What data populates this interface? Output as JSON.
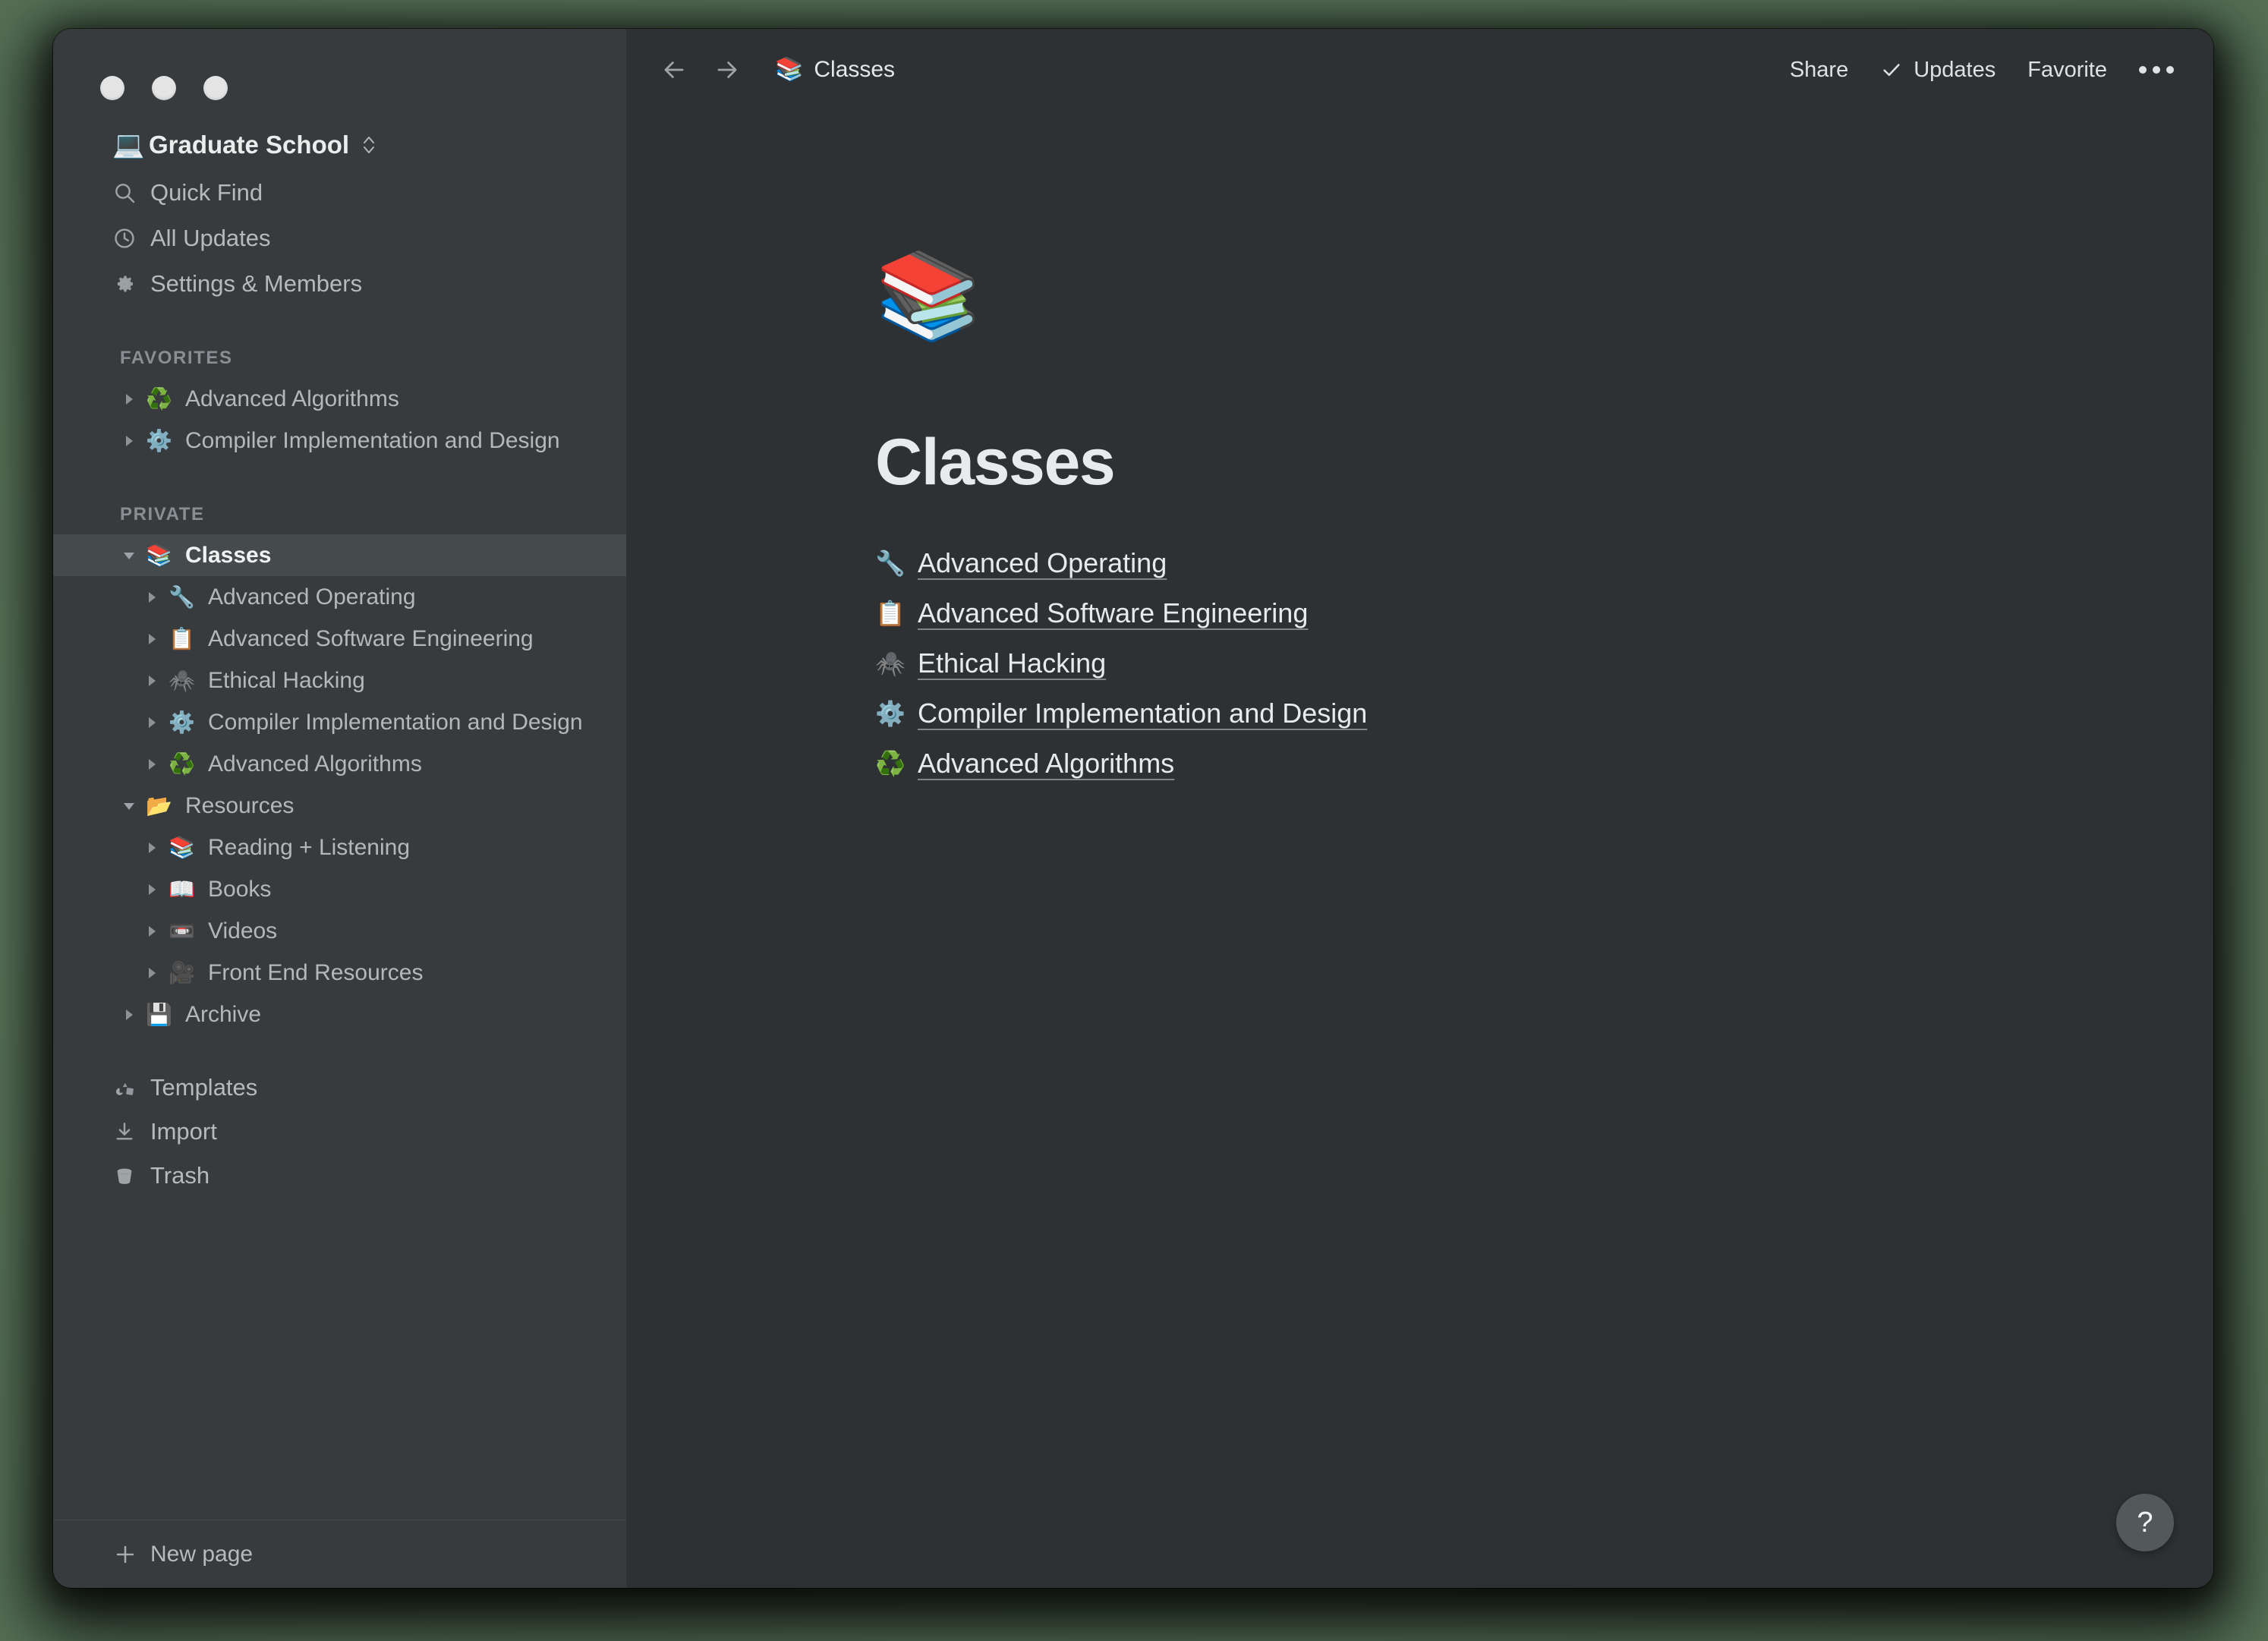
{
  "window": {
    "traffic_lights": [
      "close",
      "minimize",
      "zoom"
    ]
  },
  "sidebar": {
    "workspace": {
      "emoji": "💻",
      "icon_name": "laptop-emoji",
      "name": "Graduate School",
      "switcher_icon": "chevron-up-down-icon"
    },
    "nav": [
      {
        "label": "Quick Find",
        "icon": "search-icon"
      },
      {
        "label": "All Updates",
        "icon": "clock-icon"
      },
      {
        "label": "Settings & Members",
        "icon": "gear-icon"
      }
    ],
    "sections": [
      {
        "title": "FAVORITES",
        "items": [
          {
            "label": "Advanced Algorithms",
            "emoji": "♻️",
            "icon_name": "recycle-emoji",
            "expanded": false,
            "level": 0
          },
          {
            "label": "Compiler Implementation and Design",
            "emoji": "⚙️",
            "icon_name": "gear-emoji",
            "expanded": false,
            "level": 0
          }
        ]
      },
      {
        "title": "PRIVATE",
        "items": [
          {
            "label": "Classes",
            "emoji": "📚",
            "icon_name": "books-emoji",
            "expanded": true,
            "level": 0,
            "selected": true
          },
          {
            "label": "Advanced Operating",
            "emoji": "🔧",
            "icon_name": "wrench-emoji",
            "expanded": false,
            "level": 1
          },
          {
            "label": "Advanced Software Engineering",
            "emoji": "📋",
            "icon_name": "clipboard-emoji",
            "expanded": false,
            "level": 1
          },
          {
            "label": "Ethical Hacking",
            "emoji": "🕷️",
            "icon_name": "spider-emoji",
            "expanded": false,
            "level": 1
          },
          {
            "label": "Compiler Implementation and Design",
            "emoji": "⚙️",
            "icon_name": "gear-emoji",
            "expanded": false,
            "level": 1
          },
          {
            "label": "Advanced Algorithms",
            "emoji": "♻️",
            "icon_name": "recycle-emoji",
            "expanded": false,
            "level": 1
          },
          {
            "label": "Resources",
            "emoji": "📂",
            "icon_name": "open-folder-emoji",
            "expanded": true,
            "level": 0
          },
          {
            "label": "Reading + Listening",
            "emoji": "📚",
            "icon_name": "books-emoji",
            "expanded": false,
            "level": 1
          },
          {
            "label": "Books",
            "emoji": "📖",
            "icon_name": "open-book-emoji",
            "expanded": false,
            "level": 1
          },
          {
            "label": "Videos",
            "emoji": "📼",
            "icon_name": "videocassette-emoji",
            "expanded": false,
            "level": 1
          },
          {
            "label": "Front End Resources",
            "emoji": "🎥",
            "icon_name": "movie-camera-emoji",
            "expanded": false,
            "level": 1
          },
          {
            "label": "Archive",
            "emoji": "💾",
            "icon_name": "floppy-disk-emoji",
            "expanded": false,
            "level": 0
          }
        ]
      }
    ],
    "utilities": [
      {
        "label": "Templates",
        "icon": "templates-icon"
      },
      {
        "label": "Import",
        "icon": "import-icon"
      },
      {
        "label": "Trash",
        "icon": "trash-icon"
      }
    ],
    "footer": {
      "new_page_label": "New page",
      "plus_icon": "plus-icon"
    }
  },
  "topbar": {
    "back_icon": "arrow-left-icon",
    "forward_icon": "arrow-right-icon",
    "breadcrumb": {
      "emoji": "📚",
      "icon_name": "books-emoji",
      "label": "Classes"
    },
    "share_label": "Share",
    "updates_label": "Updates",
    "updates_check_icon": "check-icon",
    "favorite_label": "Favorite",
    "more_icon": "ellipsis-icon"
  },
  "page": {
    "emoji": "📚",
    "emoji_icon_name": "books-emoji",
    "title": "Classes",
    "links": [
      {
        "label": "Advanced Operating",
        "emoji": "🔧",
        "icon_name": "wrench-emoji"
      },
      {
        "label": "Advanced Software Engineering",
        "emoji": "📋",
        "icon_name": "clipboard-emoji"
      },
      {
        "label": "Ethical Hacking",
        "emoji": "🕷️",
        "icon_name": "spider-emoji"
      },
      {
        "label": "Compiler Implementation and Design",
        "emoji": "⚙️",
        "icon_name": "gear-emoji"
      },
      {
        "label": "Advanced Algorithms",
        "emoji": "♻️",
        "icon_name": "recycle-emoji"
      }
    ]
  },
  "help": {
    "label": "?",
    "icon_name": "question-mark-icon"
  },
  "colors": {
    "sidebar_bg": "#373b3e",
    "main_bg": "#2d3134",
    "selected_row": "#454a4d",
    "text_primary": "#e9eaeb",
    "text_secondary": "#b4b8bb",
    "text_muted": "#898e92",
    "desktop_bg": "#5d7a5d"
  }
}
